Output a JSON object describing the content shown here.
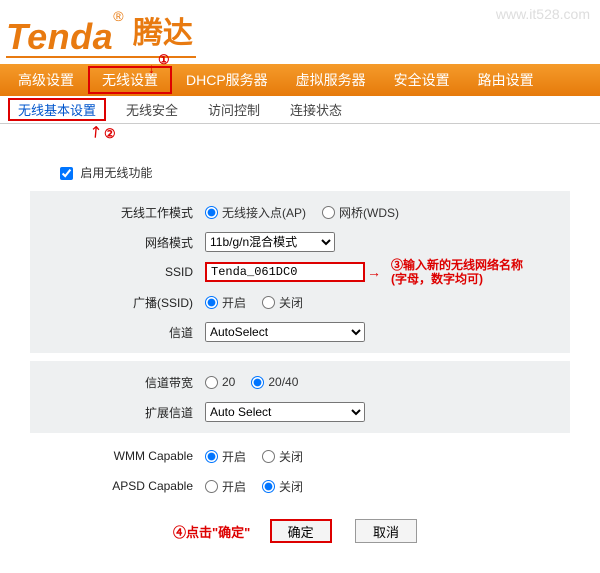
{
  "watermark": "www.it528.com",
  "logo": {
    "en": "Tenda",
    "reg": "®",
    "cn": "腾达"
  },
  "annotations": {
    "a1": "①",
    "a2": "②",
    "a3_line1": "③输入新的无线网络名称",
    "a3_line2": "(字母，数字均可)",
    "a4": "④点击\"确定\""
  },
  "mainnav": [
    {
      "label": "高级设置",
      "name": "nav-advanced"
    },
    {
      "label": "无线设置",
      "name": "nav-wireless",
      "highlight": true
    },
    {
      "label": "DHCP服务器",
      "name": "nav-dhcp"
    },
    {
      "label": "虚拟服务器",
      "name": "nav-vserver"
    },
    {
      "label": "安全设置",
      "name": "nav-security"
    },
    {
      "label": "路由设置",
      "name": "nav-routing"
    }
  ],
  "subnav": [
    {
      "label": "无线基本设置",
      "name": "sub-basic",
      "active": true
    },
    {
      "label": "无线安全",
      "name": "sub-security"
    },
    {
      "label": "访问控制",
      "name": "sub-access"
    },
    {
      "label": "连接状态",
      "name": "sub-status"
    }
  ],
  "enable_wireless_label": "启用无线功能",
  "rows": {
    "work_mode": {
      "label": "无线工作模式",
      "opt_ap": "无线接入点(AP)",
      "opt_wds": "网桥(WDS)"
    },
    "net_mode": {
      "label": "网络模式",
      "value": "11b/g/n混合模式"
    },
    "ssid": {
      "label": "SSID",
      "value": "Tenda_061DC0"
    },
    "broadcast": {
      "label": "广播(SSID)",
      "opt_on": "开启",
      "opt_off": "关闭"
    },
    "channel": {
      "label": "信道",
      "value": "AutoSelect"
    },
    "bandwidth": {
      "label": "信道带宽",
      "opt_20": "20",
      "opt_2040": "20/40"
    },
    "ext_channel": {
      "label": "扩展信道",
      "value": "Auto Select"
    },
    "wmm": {
      "label": "WMM Capable",
      "opt_on": "开启",
      "opt_off": "关闭"
    },
    "apsd": {
      "label": "APSD Capable",
      "opt_on": "开启",
      "opt_off": "关闭"
    }
  },
  "buttons": {
    "ok": "确定",
    "cancel": "取消"
  }
}
